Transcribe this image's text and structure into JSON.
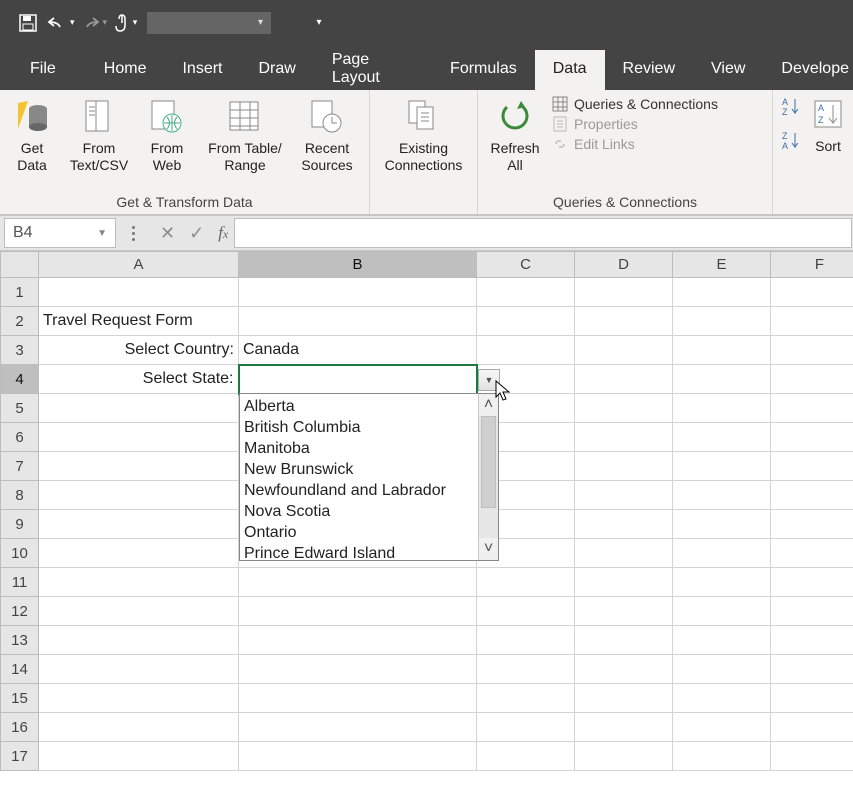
{
  "qat": {
    "combo_value": ""
  },
  "tabs": {
    "file": "File",
    "home": "Home",
    "insert": "Insert",
    "draw": "Draw",
    "page_layout": "Page Layout",
    "formulas": "Formulas",
    "data": "Data",
    "review": "Review",
    "view": "View",
    "developer": "Develope"
  },
  "ribbon": {
    "group1": {
      "label": "Get & Transform Data",
      "get_data": "Get\nData",
      "from_csv": "From\nText/CSV",
      "from_web": "From\nWeb",
      "from_table": "From Table/\nRange",
      "recent": "Recent\nSources",
      "existing": "Existing\nConnections"
    },
    "group2": {
      "label": "Queries & Connections",
      "refresh": "Refresh\nAll",
      "queries": "Queries & Connections",
      "properties": "Properties",
      "links": "Edit Links"
    },
    "group3": {
      "sort": "Sort"
    }
  },
  "namebox": "B4",
  "sheet": {
    "A2": "Travel Request Form",
    "A3": "Select Country:",
    "B3": "Canada",
    "A4": "Select State:"
  },
  "dropdown": {
    "items": [
      "Alberta",
      "British Columbia",
      "Manitoba",
      "New Brunswick",
      "Newfoundland and Labrador",
      "Nova Scotia",
      "Ontario",
      "Prince Edward Island"
    ]
  },
  "chart_data": null
}
